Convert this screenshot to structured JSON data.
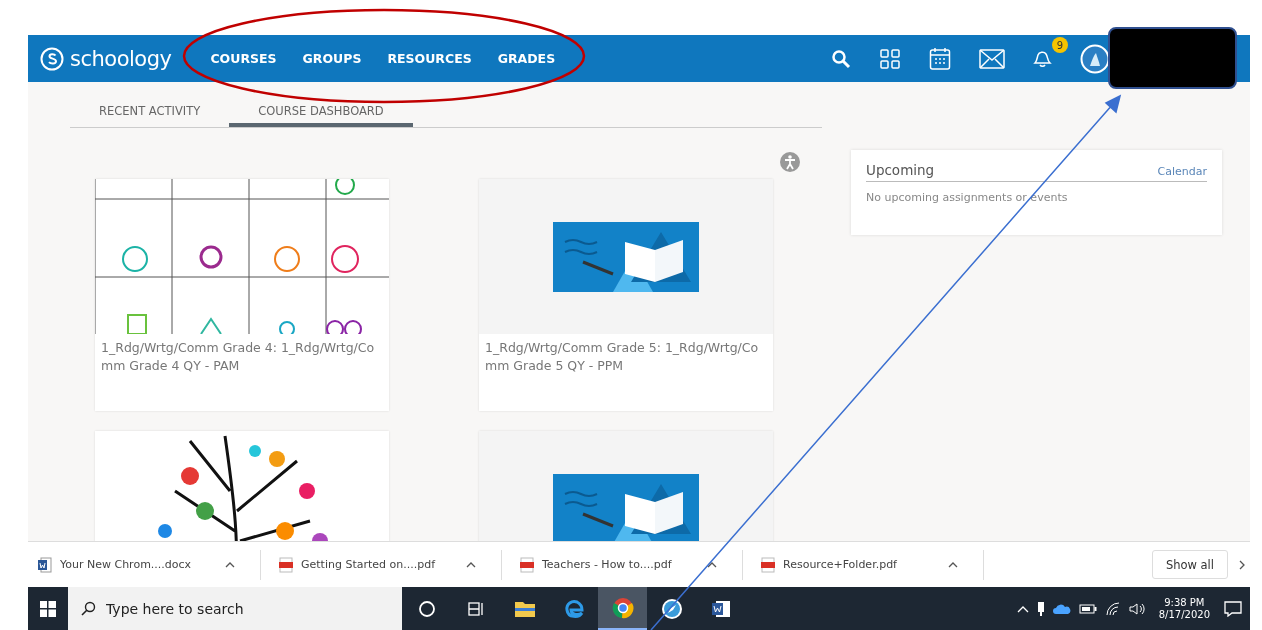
{
  "header": {
    "logo": "schoology",
    "links": [
      {
        "label": "COURSES"
      },
      {
        "label": "GROUPS"
      },
      {
        "label": "RESOURCES"
      },
      {
        "label": "GRADES"
      }
    ],
    "notification_count": "9"
  },
  "tabs": [
    {
      "label": "RECENT ACTIVITY",
      "selected": false
    },
    {
      "label": "COURSE DASHBOARD",
      "selected": true
    }
  ],
  "courses": [
    {
      "title": "1_Rdg/Wrtg/Comm Grade 4: 1_Rdg/Wrtg/Comm Grade 4 QY - PAM",
      "kind": "skills-chart"
    },
    {
      "title": "1_Rdg/Wrtg/Comm Grade 5: 1_Rdg/Wrtg/Comm Grade 5 QY - PPM",
      "kind": "book"
    },
    {
      "kind": "numbers-tree"
    },
    {
      "kind": "book"
    }
  ],
  "upcoming": {
    "title": "Upcoming",
    "link": "Calendar",
    "empty_text": "No upcoming assignments or events"
  },
  "downloads": {
    "items": [
      {
        "name": "Your New Chrom....docx",
        "kind": "docx"
      },
      {
        "name": "Getting Started on....pdf",
        "kind": "pdf"
      },
      {
        "name": "Teachers - How to....pdf",
        "kind": "pdf"
      },
      {
        "name": "Resource+Folder.pdf",
        "kind": "pdf"
      }
    ],
    "show_all": "Show all"
  },
  "taskbar": {
    "search_placeholder": "Type here to search",
    "apps": [
      {
        "kind": "cortana",
        "selected": false
      },
      {
        "kind": "task-view",
        "selected": false
      },
      {
        "kind": "folder",
        "selected": false
      },
      {
        "kind": "edge",
        "selected": false
      },
      {
        "kind": "chrome",
        "selected": true
      },
      {
        "kind": "compass",
        "selected": false
      },
      {
        "kind": "word",
        "selected": false
      }
    ],
    "time": "9:38 PM",
    "date": "8/17/2020"
  }
}
